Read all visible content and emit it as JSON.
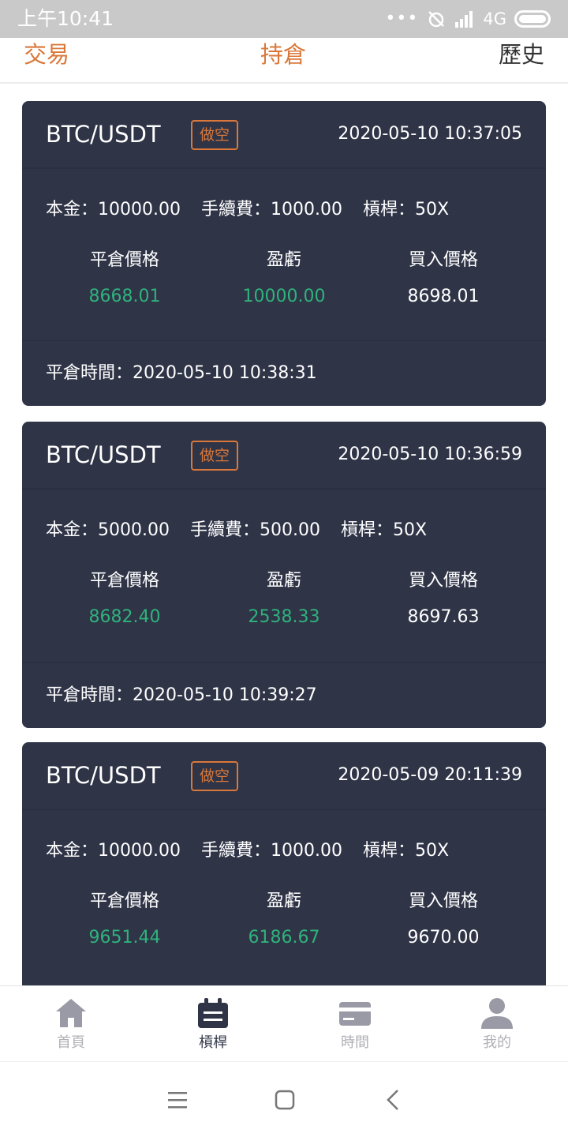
{
  "status_bar": {
    "time": "上午10:41",
    "network": "4G"
  },
  "tabs": {
    "trade": "交易",
    "position": "持倉",
    "history": "歷史"
  },
  "cards": [
    {
      "pair": "BTC/USDT",
      "badge": "做空",
      "time": "2020-05-10 10:37:05",
      "principal_label": "本金：",
      "principal": "10000.00",
      "fee_label": "手續費：",
      "fee": "1000.00",
      "leverage_label": "槓桿：",
      "leverage": "50X",
      "close_price_label": "平倉價格",
      "close_price": "8668.01",
      "pnl_label": "盈虧",
      "pnl": "10000.00",
      "buy_price_label": "買入價格",
      "buy_price": "8698.01",
      "close_time_label": "平倉時間：",
      "close_time": "2020-05-10 10:38:31"
    },
    {
      "pair": "BTC/USDT",
      "badge": "做空",
      "time": "2020-05-10 10:36:59",
      "principal_label": "本金：",
      "principal": "5000.00",
      "fee_label": "手續費：",
      "fee": "500.00",
      "leverage_label": "槓桿：",
      "leverage": "50X",
      "close_price_label": "平倉價格",
      "close_price": "8682.40",
      "pnl_label": "盈虧",
      "pnl": "2538.33",
      "buy_price_label": "買入價格",
      "buy_price": "8697.63",
      "close_time_label": "平倉時間：",
      "close_time": "2020-05-10 10:39:27"
    },
    {
      "pair": "BTC/USDT",
      "badge": "做空",
      "time": "2020-05-09 20:11:39",
      "principal_label": "本金：",
      "principal": "10000.00",
      "fee_label": "手續費：",
      "fee": "1000.00",
      "leverage_label": "槓桿：",
      "leverage": "50X",
      "close_price_label": "平倉價格",
      "close_price": "9651.44",
      "pnl_label": "盈虧",
      "pnl": "6186.67",
      "buy_price_label": "買入價格",
      "buy_price": "9670.00"
    }
  ],
  "bottom_nav": [
    {
      "label": "首頁",
      "icon": "home-icon"
    },
    {
      "label": "槓桿",
      "icon": "leverage-icon",
      "active": true
    },
    {
      "label": "時間",
      "icon": "card-icon"
    },
    {
      "label": "我的",
      "icon": "user-icon"
    }
  ],
  "colors": {
    "accent": "#d9783a",
    "card_bg": "#2f3447",
    "positive": "#2fb27c",
    "nav_inactive": "#b0b0b6"
  }
}
